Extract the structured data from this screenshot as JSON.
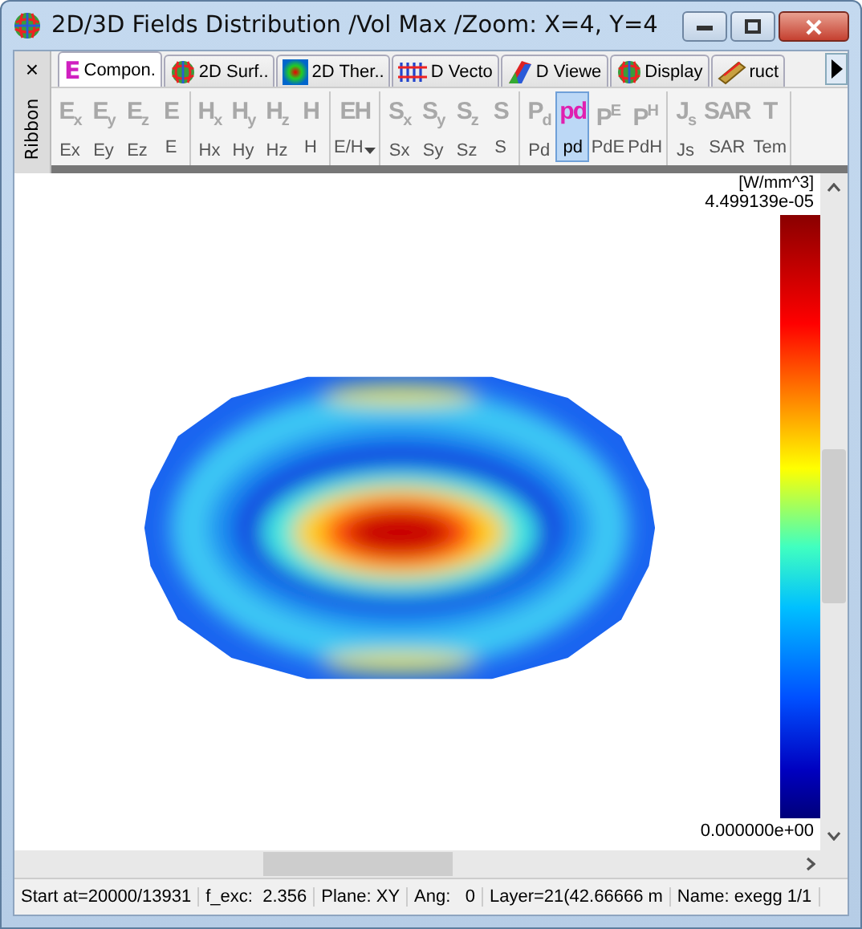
{
  "window": {
    "title": "2D/3D Fields Distribution /Vol Max /Zoom: X=4, Y=4"
  },
  "side_panel": {
    "close": "×",
    "label": "Ribbon"
  },
  "tabs": [
    {
      "label": "Compon.",
      "selected": true,
      "kind": "letter",
      "glyph": "E"
    },
    {
      "label": "2D Surf..",
      "selected": false,
      "kind": "mesh"
    },
    {
      "label": "2D Ther..",
      "selected": false,
      "kind": "thermal"
    },
    {
      "label": "D Vecto",
      "selected": false,
      "kind": "vectors"
    },
    {
      "label": "D Viewe",
      "selected": false,
      "kind": "viewer"
    },
    {
      "label": "Display",
      "selected": false,
      "kind": "mesh"
    },
    {
      "label": "ruct",
      "selected": false,
      "kind": "bar"
    }
  ],
  "ribbon_groups": [
    [
      {
        "glyph": "E$_{x}$",
        "label": "Ex",
        "selected": false,
        "dropdown": false
      },
      {
        "glyph": "E$_{y}$",
        "label": "Ey",
        "selected": false,
        "dropdown": false
      },
      {
        "glyph": "E$_{z}$",
        "label": "Ez",
        "selected": false,
        "dropdown": false
      },
      {
        "glyph": "E",
        "label": "E",
        "selected": false,
        "dropdown": false
      }
    ],
    [
      {
        "glyph": "H$_{x}$",
        "label": "Hx",
        "selected": false,
        "dropdown": false
      },
      {
        "glyph": "H$_{y}$",
        "label": "Hy",
        "selected": false,
        "dropdown": false
      },
      {
        "glyph": "H$_{z}$",
        "label": "Hz",
        "selected": false,
        "dropdown": false
      },
      {
        "glyph": "H",
        "label": "H",
        "selected": false,
        "dropdown": false
      }
    ],
    [
      {
        "glyph": "EH",
        "label": "E/H",
        "selected": false,
        "dropdown": true
      }
    ],
    [
      {
        "glyph": "S$_{x}$",
        "label": "Sx",
        "selected": false,
        "dropdown": false
      },
      {
        "glyph": "S$_{y}$",
        "label": "Sy",
        "selected": false,
        "dropdown": false
      },
      {
        "glyph": "S$_{z}$",
        "label": "Sz",
        "selected": false,
        "dropdown": false
      },
      {
        "glyph": "S",
        "label": "S",
        "selected": false,
        "dropdown": false
      }
    ],
    [
      {
        "glyph": "P$_{d}$",
        "label": "Pd",
        "selected": false,
        "dropdown": false
      },
      {
        "glyph": "pd",
        "label": "pd",
        "selected": true,
        "dropdown": false
      },
      {
        "glyph": "P$^{E}$",
        "label": "PdE",
        "selected": false,
        "dropdown": false
      },
      {
        "glyph": "P$^{H}$",
        "label": "PdH",
        "selected": false,
        "dropdown": false
      }
    ],
    [
      {
        "glyph": "J$_{s}$",
        "label": "Js",
        "selected": false,
        "dropdown": false
      },
      {
        "glyph": "SAR",
        "label": "SAR",
        "selected": false,
        "dropdown": false
      },
      {
        "glyph": "T",
        "label": "Tem",
        "selected": false,
        "dropdown": false
      }
    ]
  ],
  "legend": {
    "unit": "[W/mm^3]",
    "max": "4.499139e-05",
    "min": "0.000000e+00"
  },
  "status_bar": [
    "Start at=20000/13931",
    "f_exc:  2.356",
    "Plane: XY",
    "Ang:   0",
    "Layer=21(42.66666 m",
    "Name: exegg 1/1"
  ]
}
